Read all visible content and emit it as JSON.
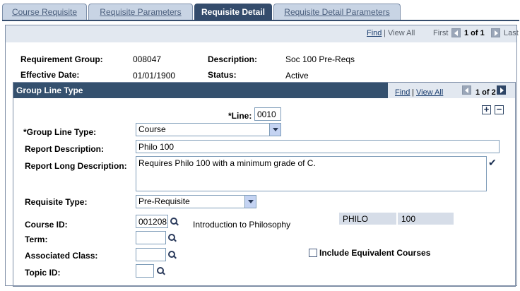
{
  "tabs": [
    {
      "label": "Course Requisite"
    },
    {
      "label": "Requisite Parameters"
    },
    {
      "label": "Requisite Detail"
    },
    {
      "label": "Requisite Detail Parameters"
    }
  ],
  "nav_top": {
    "find": "Find",
    "view_all": "View All",
    "first": "First",
    "count": "1 of 1",
    "last": "Last"
  },
  "header": {
    "req_group_label": "Requirement Group:",
    "req_group_value": "008047",
    "description_label": "Description:",
    "description_value": "Soc 100 Pre-Reqs",
    "eff_date_label": "Effective Date:",
    "eff_date_value": "01/01/1900",
    "status_label": "Status:",
    "status_value": "Active"
  },
  "group_line": {
    "title": "Group Line Type",
    "find": "Find",
    "view_all": "View All",
    "count": "1 of 2",
    "line_label": "*Line:",
    "line_value": "0010",
    "glt_label": "*Group Line Type:",
    "glt_value": "Course",
    "report_desc_label": "Report Description:",
    "report_desc_value": "Philo 100",
    "report_long_label": "Report Long Description:",
    "report_long_value": "Requires Philo 100 with a minimum grade of C.",
    "req_type_label": "Requisite Type:",
    "req_type_value": "Pre-Requisite",
    "course_id_label": "Course ID:",
    "course_id_value": "001208",
    "course_title": "Introduction to Philosophy",
    "subject": "PHILO",
    "catalog": "100",
    "term_label": "Term:",
    "term_value": "",
    "assoc_class_label": "Associated Class:",
    "assoc_class_value": "",
    "topic_label": "Topic ID:",
    "topic_value": "",
    "include_equiv_label": "Include Equivalent Courses"
  }
}
